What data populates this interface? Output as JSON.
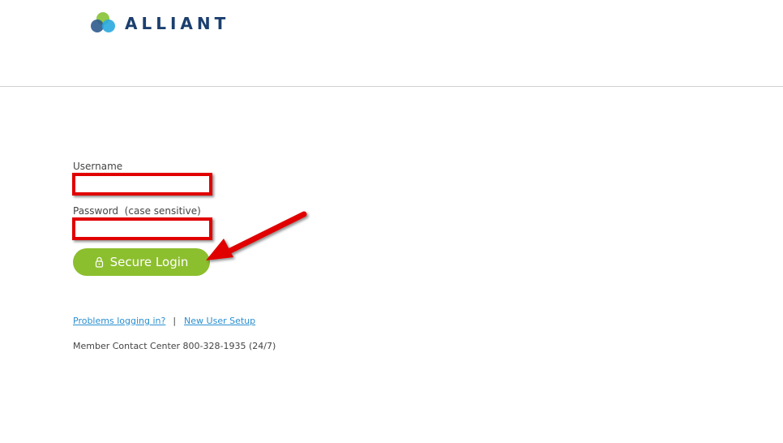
{
  "brand": {
    "name": "ALLIANT",
    "colors": {
      "navy": "#1b3f6e",
      "green": "#8cc63f",
      "blue": "#29a8e0",
      "button": "#8cbf2e",
      "link": "#2a8fd0",
      "highlight": "#e10000"
    }
  },
  "login": {
    "username_label": "Username",
    "username_value": "",
    "password_label": "Password  (case sensitive)",
    "password_value": "",
    "submit_label": "Secure Login",
    "submit_icon": "lock-icon"
  },
  "links": {
    "problems": "Problems logging in?",
    "separator": "|",
    "new_user": "New User Setup"
  },
  "contact": {
    "text": "Member Contact Center 800-328-1935 (24/7)"
  }
}
